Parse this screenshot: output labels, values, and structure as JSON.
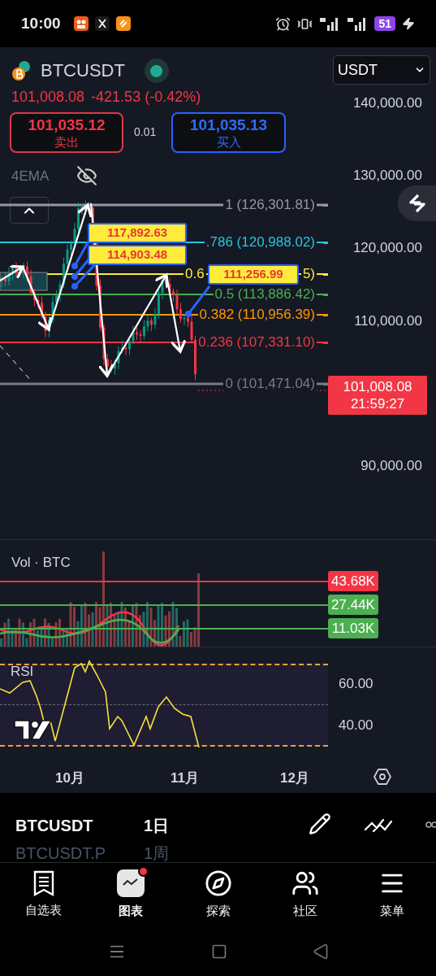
{
  "status_bar": {
    "time": "10:00",
    "battery": "51"
  },
  "symbol": {
    "name": "BTCUSDT",
    "price": "101,008.08",
    "change": "-421.53 (-0.42%)"
  },
  "currency_select": {
    "value": "USDT"
  },
  "sell": {
    "price": "101,035.12",
    "label": "卖出"
  },
  "spread": "0.01",
  "buy": {
    "price": "101,035.13",
    "label": "买入"
  },
  "indicator": {
    "label": "4EMA"
  },
  "price_axis": [
    "140,000.00",
    "130,000.00",
    "120,000.00",
    "110,000.00",
    "90,000.00"
  ],
  "fib_levels": [
    {
      "label": "1 (126,301.81)",
      "color": "#9598a1"
    },
    {
      "label": ".786 (120,988.02)",
      "color": "#26c6da"
    },
    {
      "label": "0.6",
      "tail": "5)",
      "color": "#ffeb3b"
    },
    {
      "label": "0.5 (113,886.42)",
      "color": "#4caf50"
    },
    {
      "label": "0.382 (110,956.39)",
      "color": "#ff9800"
    },
    {
      "label": "0.236 (107,331.10)",
      "color": "#f23645"
    },
    {
      "label": "0 (101,471.04)",
      "color": "#787b86"
    }
  ],
  "callouts": [
    "117,892.63",
    "114,903.48",
    "111,256.99"
  ],
  "last_price": {
    "price": "101,008.08",
    "countdown": "21:59:27"
  },
  "volume": {
    "label": "Vol · BTC",
    "tags": [
      {
        "value": "43.68K",
        "color": "#f23645"
      },
      {
        "value": "27.44K",
        "color": "#4caf50"
      },
      {
        "value": "11.03K",
        "color": "#4caf50"
      }
    ]
  },
  "rsi": {
    "label": "RSI",
    "ticks": [
      "60.00",
      "40.00"
    ]
  },
  "time_axis": [
    "10月",
    "11月",
    "12月"
  ],
  "symbol_list": [
    {
      "symbol": "BTCUSDT",
      "interval": "1日",
      "selected": true
    },
    {
      "symbol": "BTCUSDT.P",
      "interval": "1周",
      "selected": false
    }
  ],
  "bottom_nav": [
    {
      "label": "自选表",
      "selected": false,
      "badge": false
    },
    {
      "label": "图表",
      "selected": true,
      "badge": true
    },
    {
      "label": "探索",
      "selected": false,
      "badge": false
    },
    {
      "label": "社区",
      "selected": false,
      "badge": false
    },
    {
      "label": "菜单",
      "selected": false,
      "badge": false
    }
  ]
}
